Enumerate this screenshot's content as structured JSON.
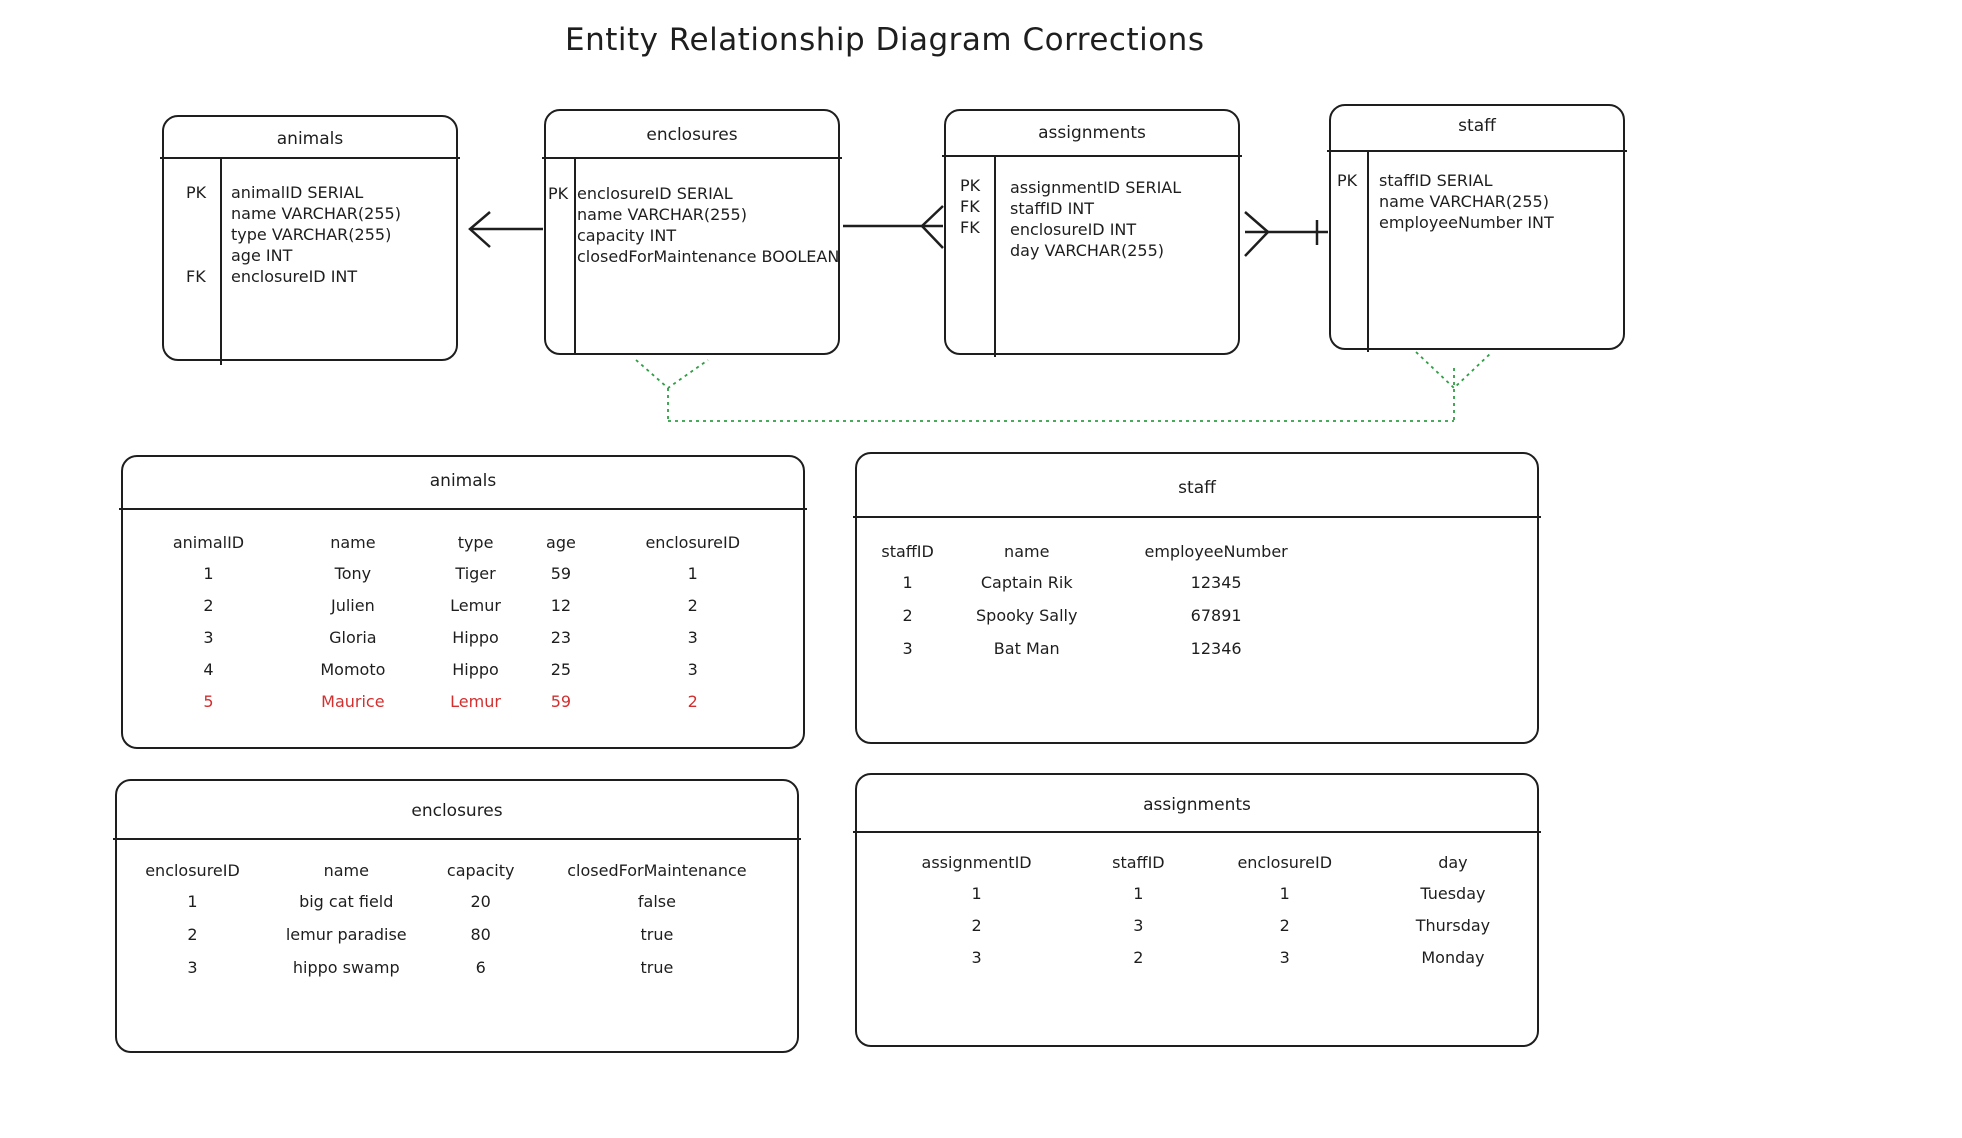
{
  "title": "Entity Relationship Diagram Corrections",
  "colors": {
    "stroke": "#1e1e1e",
    "highlight": "#d32f2f",
    "dotted": "#2f9e44"
  },
  "entities": {
    "animals": {
      "name": "animals",
      "keys": [
        "PK",
        "",
        "",
        "",
        "FK"
      ],
      "columns": [
        "animalID SERIAL",
        "name VARCHAR(255)",
        "type VARCHAR(255)",
        "age INT",
        "enclosureID INT"
      ]
    },
    "enclosures": {
      "name": "enclosures",
      "keys": [
        "PK",
        "",
        "",
        ""
      ],
      "columns": [
        "enclosureID SERIAL",
        "name VARCHAR(255)",
        "capacity INT",
        "closedForMaintenance BOOLEAN"
      ]
    },
    "assignments": {
      "name": "assignments",
      "keys": [
        "PK",
        "FK",
        "FK",
        ""
      ],
      "columns": [
        "assignmentID SERIAL",
        "staffID INT",
        "enclosureID INT",
        "day VARCHAR(255)"
      ]
    },
    "staff": {
      "name": "staff",
      "keys": [
        "PK",
        "",
        ""
      ],
      "columns": [
        "staffID SERIAL",
        "name VARCHAR(255)",
        "employeeNumber INT"
      ]
    }
  },
  "tables": {
    "animals": {
      "name": "animals",
      "headers": [
        "animalID",
        "name",
        "type",
        "age",
        "enclosureID"
      ],
      "rows": [
        [
          "1",
          "Tony",
          "Tiger",
          "59",
          "1"
        ],
        [
          "2",
          "Julien",
          "Lemur",
          "12",
          "2"
        ],
        [
          "3",
          "Gloria",
          "Hippo",
          "23",
          "3"
        ],
        [
          "4",
          "Momoto",
          "Hippo",
          "25",
          "3"
        ],
        [
          "5",
          "Maurice",
          "Lemur",
          "59",
          "2"
        ]
      ],
      "highlighted_row": 4
    },
    "staff": {
      "name": "staff",
      "headers": [
        "staffID",
        "name",
        "employeeNumber"
      ],
      "rows": [
        [
          "1",
          "Captain Rik",
          "12345"
        ],
        [
          "2",
          "Spooky Sally",
          "67891"
        ],
        [
          "3",
          "Bat Man",
          "12346"
        ]
      ]
    },
    "enclosures": {
      "name": "enclosures",
      "headers": [
        "enclosureID",
        "name",
        "capacity",
        "closedForMaintenance"
      ],
      "rows": [
        [
          "1",
          "big cat field",
          "20",
          "false"
        ],
        [
          "2",
          "lemur paradise",
          "80",
          "true"
        ],
        [
          "3",
          "hippo swamp",
          "6",
          "true"
        ]
      ]
    },
    "assignments": {
      "name": "assignments",
      "headers": [
        "assignmentID",
        "staffID",
        "enclosureID",
        "day"
      ],
      "rows": [
        [
          "1",
          "1",
          "1",
          "Tuesday"
        ],
        [
          "2",
          "3",
          "2",
          "Thursday"
        ],
        [
          "3",
          "2",
          "3",
          "Monday"
        ]
      ]
    }
  }
}
